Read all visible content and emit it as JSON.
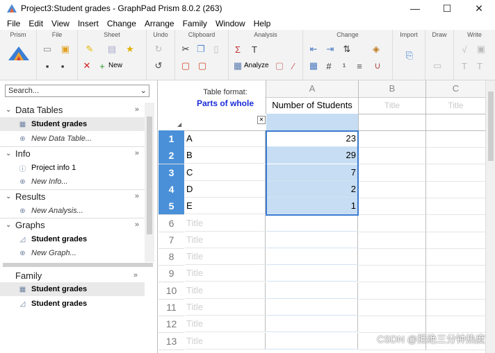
{
  "window": {
    "title": "Project3:Student grades - GraphPad Prism 8.0.2 (263)",
    "minimize": "—",
    "maximize": "☐",
    "close": "✕"
  },
  "menu": [
    "File",
    "Edit",
    "View",
    "Insert",
    "Change",
    "Arrange",
    "Family",
    "Window",
    "Help"
  ],
  "ribbon": {
    "groups": [
      "Prism",
      "File",
      "Sheet",
      "Undo",
      "Clipboard",
      "Analysis",
      "Change",
      "Import",
      "Draw",
      "Write"
    ],
    "new_label": "New",
    "analyze_label": "Analyze"
  },
  "sidebar": {
    "search_placeholder": "Search...",
    "sections": [
      {
        "label": "Data Tables",
        "items": [
          {
            "label": "Student grades",
            "style": "bold",
            "selected": true
          },
          {
            "label": "New Data Table...",
            "style": "italic"
          }
        ]
      },
      {
        "label": "Info",
        "items": [
          {
            "label": "Project info 1",
            "style": "normal"
          },
          {
            "label": "New Info...",
            "style": "italic"
          }
        ]
      },
      {
        "label": "Results",
        "items": [
          {
            "label": "New Analysis...",
            "style": "italic"
          }
        ]
      },
      {
        "label": "Graphs",
        "items": [
          {
            "label": "Student grades",
            "style": "bold"
          },
          {
            "label": "New Graph...",
            "style": "italic"
          }
        ]
      }
    ],
    "family": {
      "label": "Family",
      "items": [
        "Student grades",
        "Student grades"
      ]
    }
  },
  "table": {
    "format_label": "Table format:",
    "format_value": "Parts of whole",
    "columns": [
      {
        "letter": "A",
        "title": "Number of Students"
      },
      {
        "letter": "B",
        "title": "Title"
      },
      {
        "letter": "C",
        "title": "Title"
      }
    ],
    "rows": [
      {
        "num": "1",
        "title": "A",
        "value": "23"
      },
      {
        "num": "2",
        "title": "B",
        "value": "29"
      },
      {
        "num": "3",
        "title": "C",
        "value": "7"
      },
      {
        "num": "4",
        "title": "D",
        "value": "2"
      },
      {
        "num": "5",
        "title": "E",
        "value": "1"
      },
      {
        "num": "6",
        "title": "Title",
        "value": ""
      },
      {
        "num": "7",
        "title": "Title",
        "value": ""
      },
      {
        "num": "8",
        "title": "Title",
        "value": ""
      },
      {
        "num": "9",
        "title": "Title",
        "value": ""
      },
      {
        "num": "10",
        "title": "Title",
        "value": ""
      },
      {
        "num": "11",
        "title": "Title",
        "value": ""
      },
      {
        "num": "12",
        "title": "Title",
        "value": ""
      },
      {
        "num": "13",
        "title": "Title",
        "value": ""
      }
    ]
  },
  "watermark": "CSDN @拒绝三分钟热度"
}
